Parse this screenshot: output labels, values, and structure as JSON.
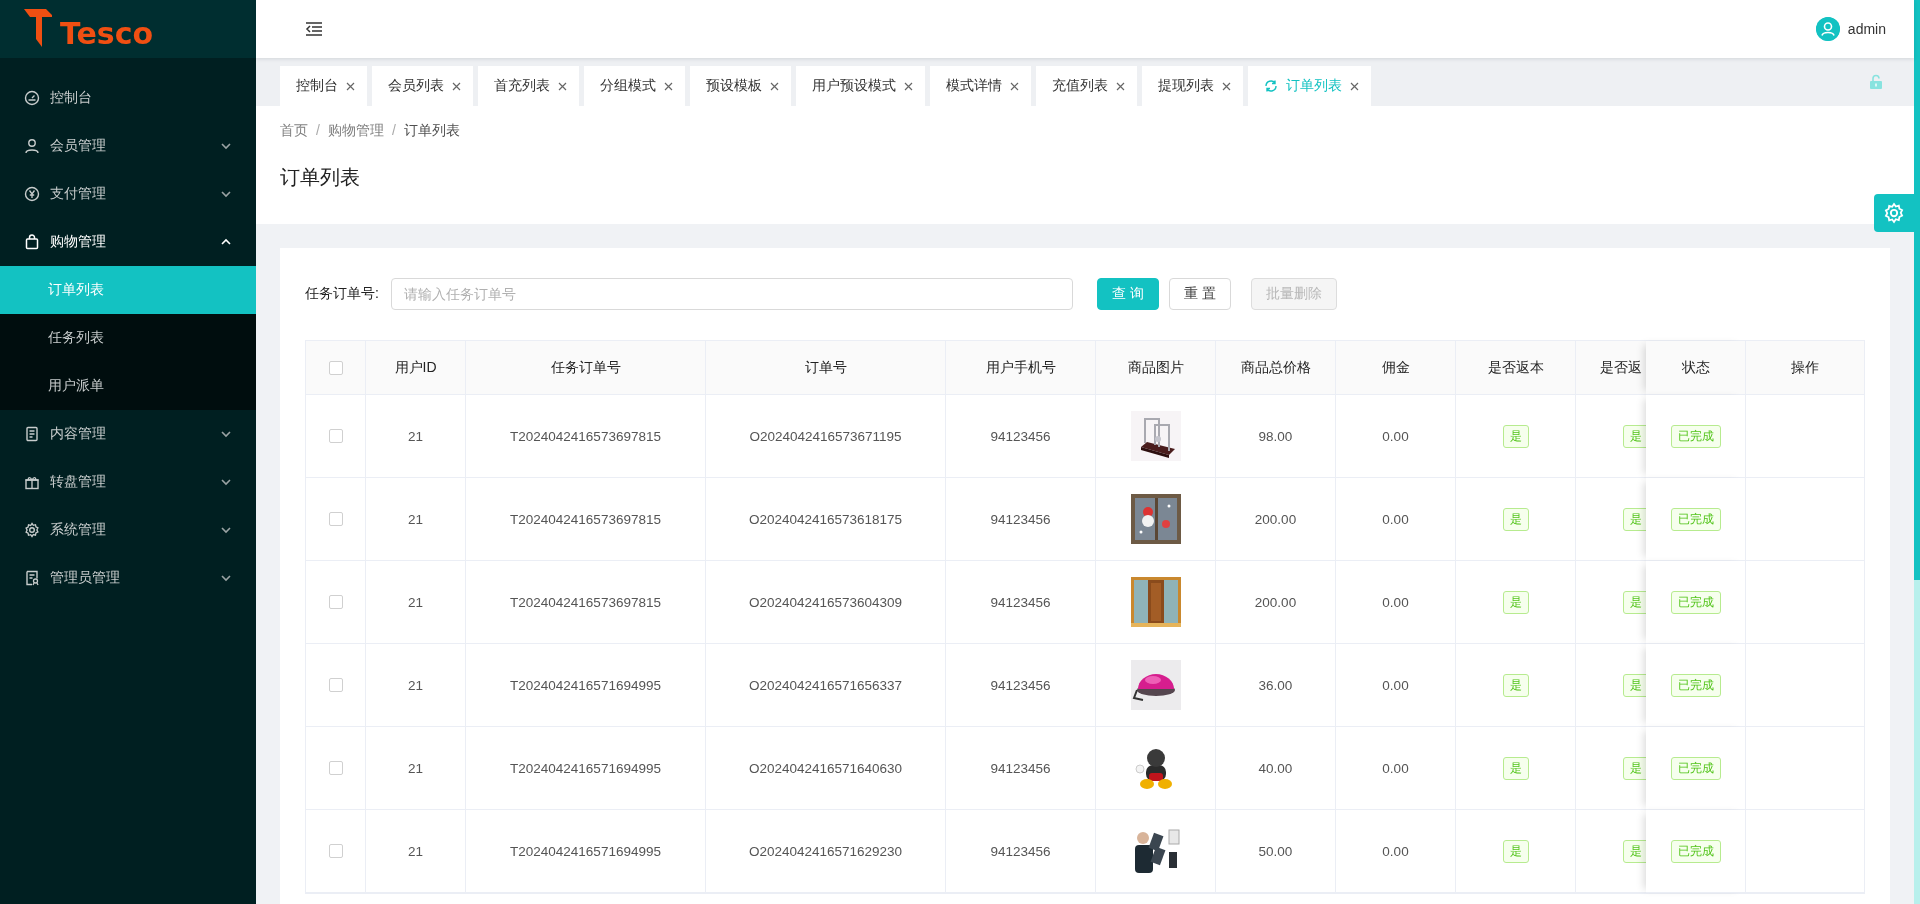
{
  "logo": {
    "text": "Tesco"
  },
  "sidebar": {
    "items": [
      {
        "label": "控制台"
      },
      {
        "label": "会员管理",
        "expanded": false
      },
      {
        "label": "支付管理",
        "expanded": false
      },
      {
        "label": "购物管理",
        "expanded": true,
        "children": [
          {
            "label": "订单列表",
            "selected": true
          },
          {
            "label": "任务列表",
            "selected": false
          },
          {
            "label": "用户派单",
            "selected": false
          }
        ]
      },
      {
        "label": "内容管理",
        "expanded": false
      },
      {
        "label": "转盘管理",
        "expanded": false
      },
      {
        "label": "系统管理",
        "expanded": false
      },
      {
        "label": "管理员管理",
        "expanded": false
      }
    ]
  },
  "header": {
    "user": "admin"
  },
  "tabs": [
    {
      "label": "控制台",
      "selected": false
    },
    {
      "label": "会员列表",
      "selected": false
    },
    {
      "label": "首充列表",
      "selected": false
    },
    {
      "label": "分组模式",
      "selected": false
    },
    {
      "label": "预设模板",
      "selected": false
    },
    {
      "label": "用户预设模式",
      "selected": false
    },
    {
      "label": "模式详情",
      "selected": false
    },
    {
      "label": "充值列表",
      "selected": false
    },
    {
      "label": "提现列表",
      "selected": false
    },
    {
      "label": "订单列表",
      "selected": true
    }
  ],
  "breadcrumb": {
    "items": [
      "首页",
      "购物管理",
      "订单列表"
    ],
    "separator": "/"
  },
  "page_title": "订单列表",
  "search": {
    "label": "任务订单号:",
    "placeholder": "请输入任务订单号"
  },
  "buttons": [
    {
      "label": "查 询",
      "kind": "primary",
      "disabled": false
    },
    {
      "label": "重 置",
      "kind": "default",
      "disabled": false
    },
    {
      "label": "批量删除",
      "kind": "default",
      "disabled": true
    }
  ],
  "table": {
    "select_all_checked": false,
    "columns": [
      "用户ID",
      "任务订单号",
      "订单号",
      "用户手机号",
      "商品图片",
      "商品总价格",
      "佣金",
      "是否返本",
      "是否返",
      "状态",
      "操作"
    ],
    "rows": [
      {
        "checked": false,
        "user_id": "21",
        "task_order": "T2024042416573697815",
        "order": "O2024042416573671195",
        "phone": "94123456",
        "price": "98.00",
        "commission": "0.00",
        "refund": "是",
        "column_10": "是",
        "status": "已完成"
      },
      {
        "checked": false,
        "user_id": "21",
        "task_order": "T2024042416573697815",
        "order": "O2024042416573618175",
        "phone": "94123456",
        "price": "200.00",
        "commission": "0.00",
        "refund": "是",
        "column_10": "是",
        "status": "已完成"
      },
      {
        "checked": false,
        "user_id": "21",
        "task_order": "T2024042416573697815",
        "order": "O2024042416573604309",
        "phone": "94123456",
        "price": "200.00",
        "commission": "0.00",
        "refund": "是",
        "column_10": "是",
        "status": "已完成"
      },
      {
        "checked": false,
        "user_id": "21",
        "task_order": "T2024042416571694995",
        "order": "O2024042416571656337",
        "phone": "94123456",
        "price": "36.00",
        "commission": "0.00",
        "refund": "是",
        "column_10": "是",
        "status": "已完成"
      },
      {
        "checked": false,
        "user_id": "21",
        "task_order": "T2024042416571694995",
        "order": "O2024042416571640630",
        "phone": "94123456",
        "price": "40.00",
        "commission": "0.00",
        "refund": "是",
        "column_10": "是",
        "status": "已完成"
      },
      {
        "checked": false,
        "user_id": "21",
        "task_order": "T2024042416571694995",
        "order": "O2024042416571629230",
        "phone": "94123456",
        "price": "50.00",
        "commission": "0.00",
        "refund": "是",
        "column_10": "是",
        "status": "已完成"
      }
    ]
  }
}
